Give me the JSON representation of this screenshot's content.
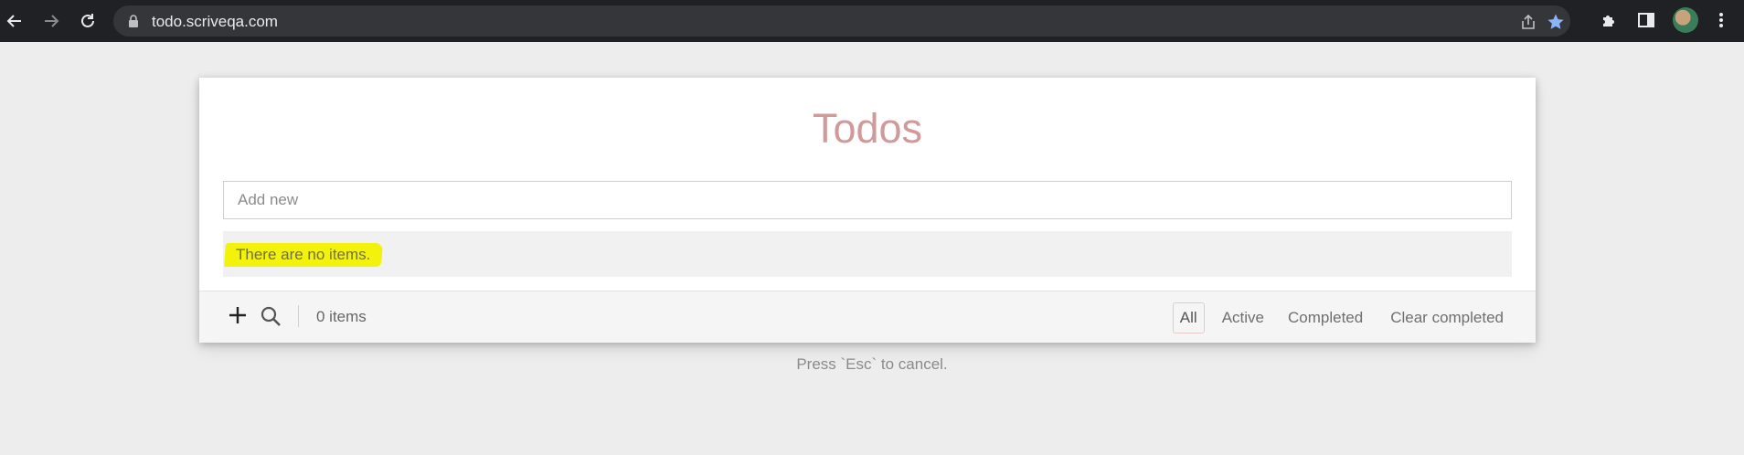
{
  "browser": {
    "url": "todo.scriveqa.com"
  },
  "app": {
    "title": "Todos",
    "add_placeholder": "Add new",
    "empty_message": "There are no items.",
    "item_count": "0 items",
    "filters": {
      "all": "All",
      "active": "Active",
      "completed": "Completed",
      "clear": "Clear completed"
    },
    "selected_filter": "All",
    "hint": "Press `Esc` to cancel."
  },
  "colors": {
    "title": "#d19a9a",
    "highlight": "#f2f20d",
    "chrome": "#202124"
  },
  "icons": [
    "back-icon",
    "forward-icon",
    "reload-icon",
    "lock-icon",
    "share-icon",
    "star-icon",
    "extensions-icon",
    "sidepanel-icon",
    "avatar",
    "menu-icon",
    "plus-icon",
    "search-icon"
  ]
}
